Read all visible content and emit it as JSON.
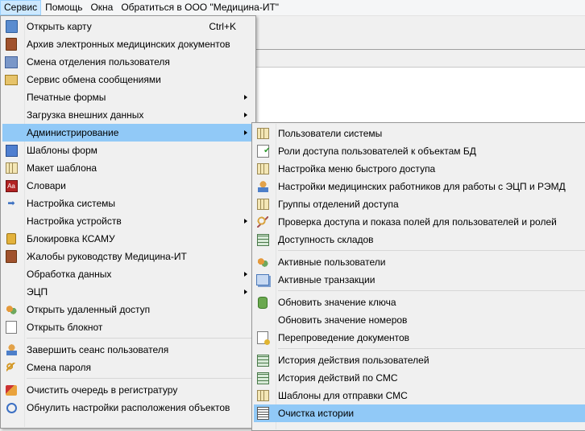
{
  "menubar": {
    "items": [
      {
        "label": "Сервис"
      },
      {
        "label": "Помощь"
      },
      {
        "label": "Окна"
      },
      {
        "label": "Обратиться в ООО \"Медицина-ИТ\""
      }
    ]
  },
  "service_menu": {
    "items": [
      {
        "label": "Открыть карту",
        "shortcut": "Ctrl+K",
        "icon": "card-icon"
      },
      {
        "label": "Архив электронных медицинских документов",
        "icon": "book-icon"
      },
      {
        "label": "Смена отделения пользователя",
        "icon": "swap-icon"
      },
      {
        "label": "Сервис обмена сообщениями",
        "icon": "mail-icon"
      },
      {
        "label": "Печатные формы",
        "submenu": true
      },
      {
        "label": "Загрузка внешних данных",
        "submenu": true
      },
      {
        "label": "Администрирование",
        "submenu": true,
        "highlighted": true
      },
      {
        "label": "Шаблоны форм",
        "icon": "form-icon"
      },
      {
        "label": "Макет шаблона",
        "icon": "grid-icon"
      },
      {
        "label": "Словари",
        "icon": "dictionary-icon"
      },
      {
        "label": "Настройка системы",
        "icon": "arrow-icon"
      },
      {
        "label": "Настройка устройств",
        "submenu": true
      },
      {
        "label": "Блокировка КСАМУ",
        "icon": "lock-icon"
      },
      {
        "label": "Жалобы руководству Медицина-ИТ",
        "icon": "book-icon"
      },
      {
        "label": "Обработка данных",
        "submenu": true
      },
      {
        "label": "ЭЦП",
        "submenu": true
      },
      {
        "label": "Открыть удаленный доступ",
        "icon": "people-icon"
      },
      {
        "label": "Открыть блокнот",
        "icon": "notepad-icon"
      },
      {
        "label": "Завершить сеанс пользователя",
        "icon": "user-icon"
      },
      {
        "label": "Смена пароля",
        "icon": "key-icon"
      },
      {
        "label": "Очистить очередь в регистратуру",
        "icon": "clear-icon"
      },
      {
        "label": "Обнулить настройки расположения объектов",
        "icon": "reset-icon"
      }
    ]
  },
  "admin_menu": {
    "items": [
      {
        "label": "Пользователи системы",
        "icon": "grid-icon"
      },
      {
        "label": "Роли доступа пользователей к объектам БД",
        "icon": "check-doc-icon"
      },
      {
        "label": "Настройка меню быстрого доступа",
        "icon": "grid-icon"
      },
      {
        "label": "Настройки медицинских работников для работы с ЭЦП и РЭМД",
        "icon": "user-icon"
      },
      {
        "label": "Группы отделений доступа",
        "icon": "grid-icon"
      },
      {
        "label": "Проверка доступа и показа полей для пользователей и ролей",
        "icon": "search-icon"
      },
      {
        "label": "Доступность складов",
        "icon": "table-icon"
      },
      {
        "label": "Активные пользователи",
        "icon": "people-icon"
      },
      {
        "label": "Активные транзакции",
        "icon": "windows-icon"
      },
      {
        "label": "Обновить значение ключа",
        "icon": "database-icon"
      },
      {
        "label": "Обновить значение номеров"
      },
      {
        "label": "Перепроведение документов",
        "icon": "document-icon"
      },
      {
        "label": "История действия пользователей",
        "icon": "table-icon"
      },
      {
        "label": "История действий по СМС",
        "icon": "table-icon"
      },
      {
        "label": "Шаблоны для отправки СМС",
        "icon": "grid-icon"
      },
      {
        "label": "Очистка истории",
        "icon": "list-icon",
        "highlighted": true
      }
    ]
  }
}
